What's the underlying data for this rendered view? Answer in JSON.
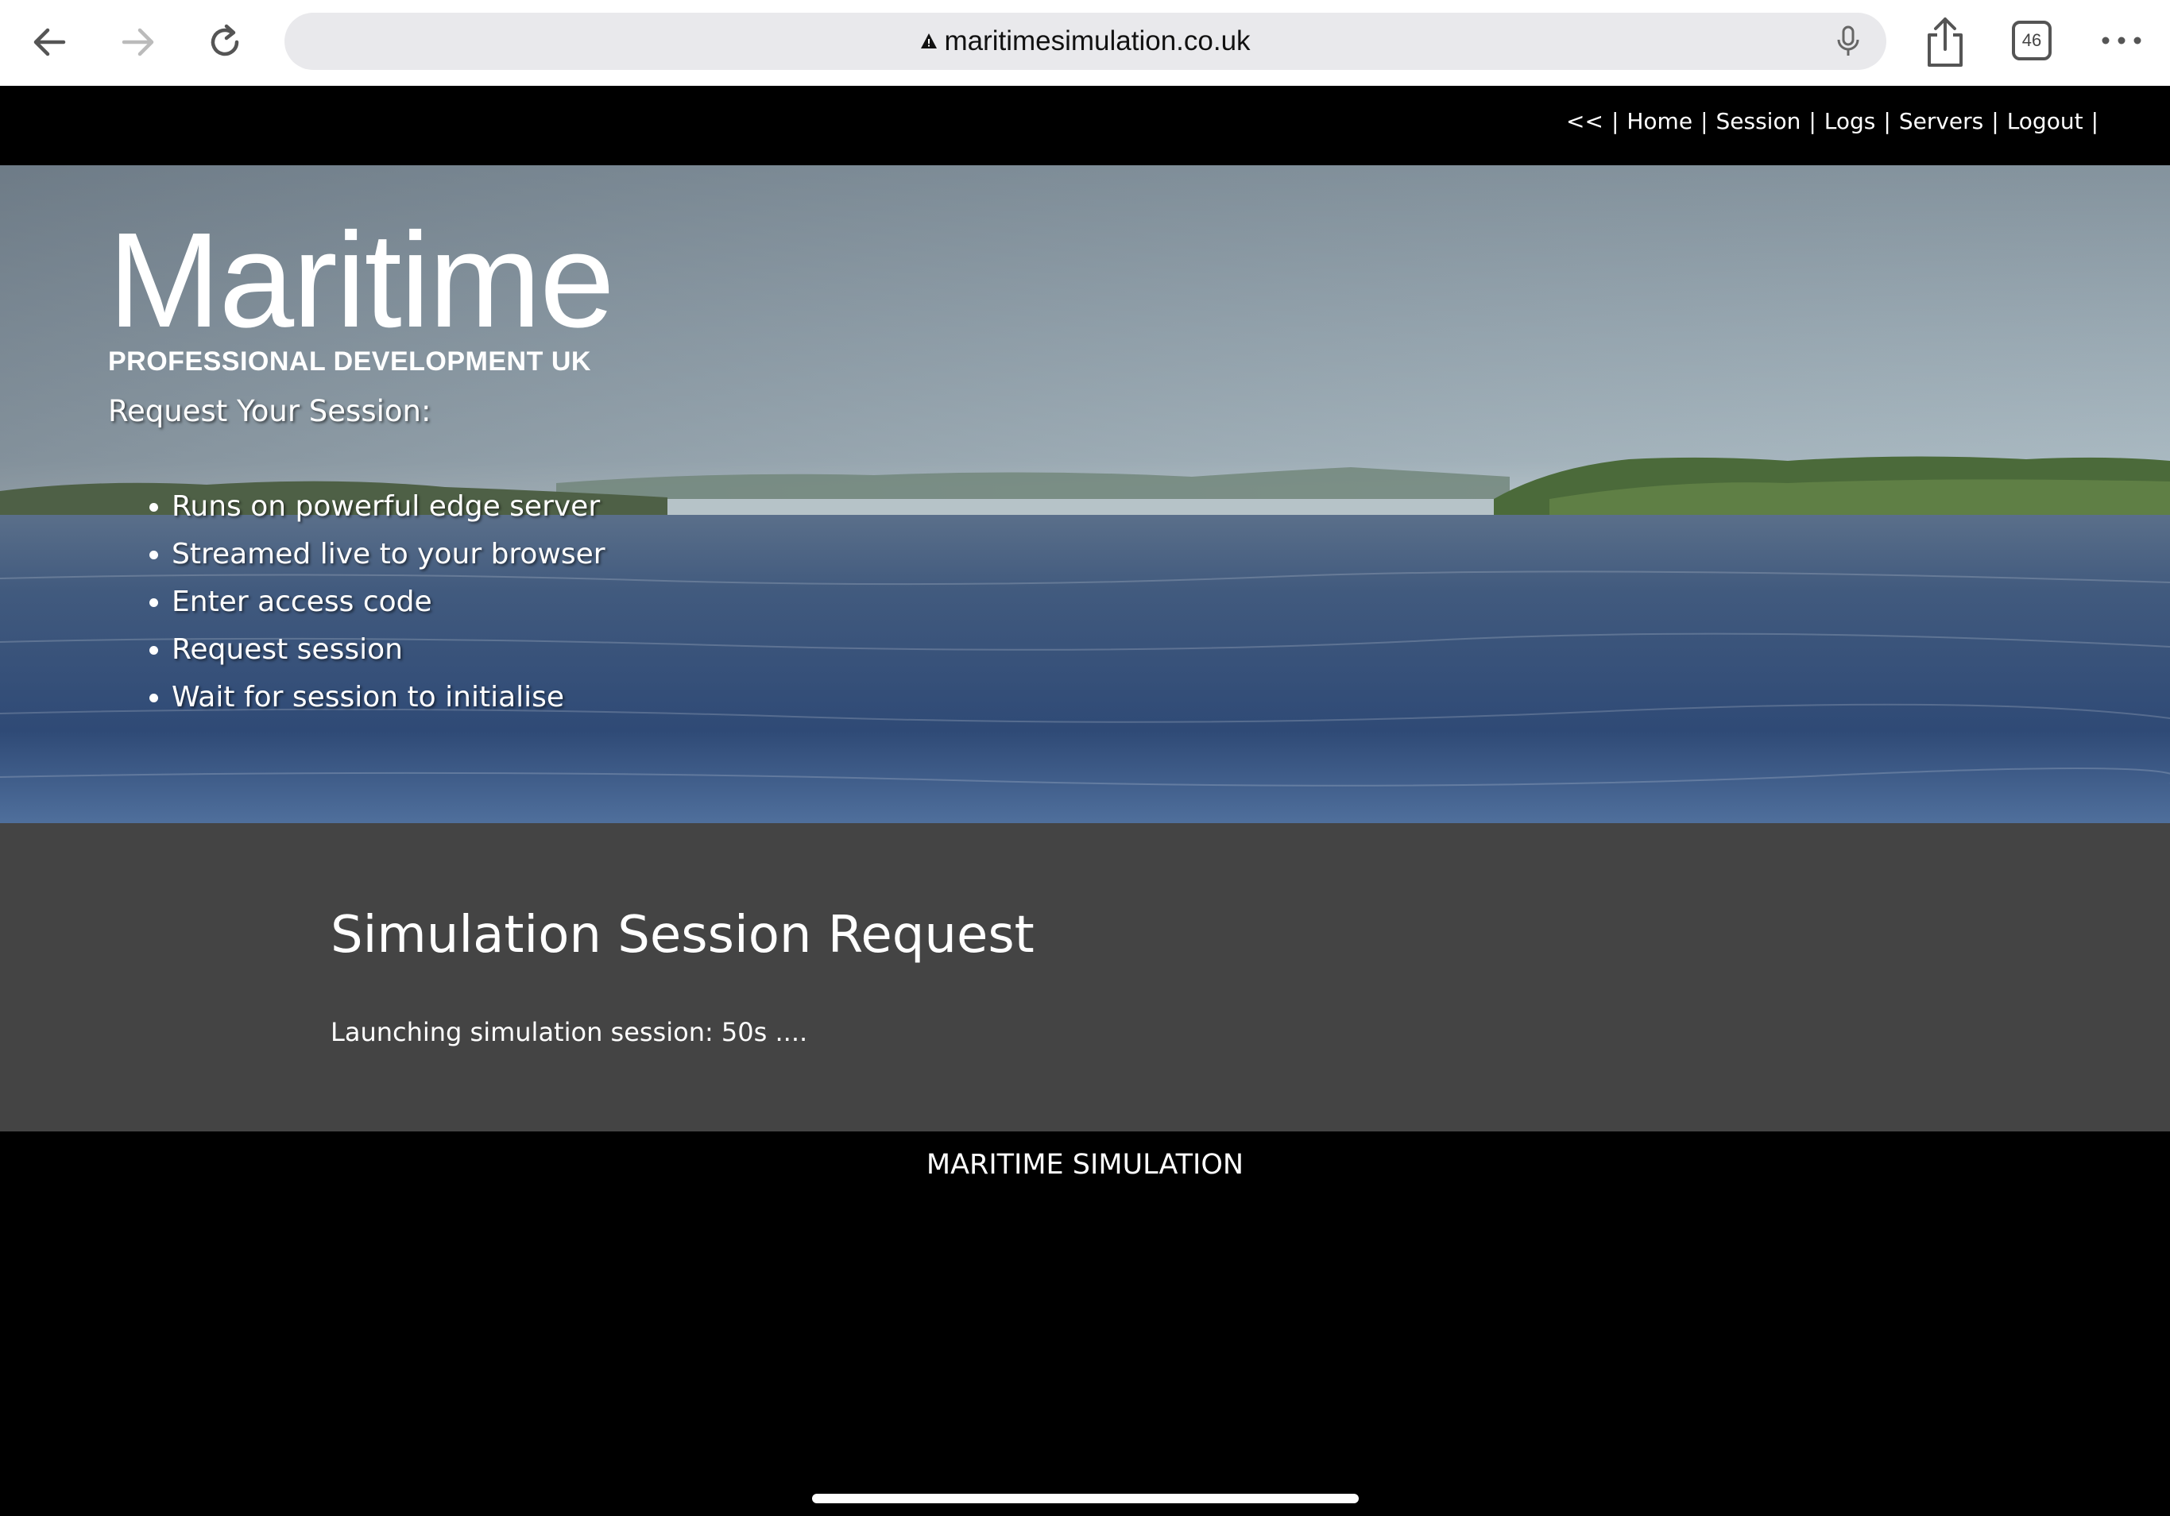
{
  "browser": {
    "url": "maritimesimulation.co.uk",
    "tab_count": "46"
  },
  "site_nav": {
    "items": [
      {
        "label": "<<"
      },
      {
        "label": "Home"
      },
      {
        "label": "Session"
      },
      {
        "label": "Logs"
      },
      {
        "label": "Servers"
      },
      {
        "label": "Logout"
      }
    ],
    "separator": "|"
  },
  "hero": {
    "logo_word": "Maritime",
    "logo_sub": "PROFESSIONAL DEVELOPMENT UK",
    "heading": "Request Your Session:",
    "features": [
      "Runs on powerful edge server",
      "Streamed live to your browser",
      "Enter access code",
      "Request session",
      "Wait for session to initialise"
    ]
  },
  "content": {
    "title": "Simulation Session Request",
    "status": "Launching simulation session: 50s ...."
  },
  "footer": {
    "text": "MARITIME SIMULATION"
  },
  "colors": {
    "content_bg": "#444444",
    "nav_bg": "#000000",
    "url_bar_bg": "#e9e9ec"
  }
}
